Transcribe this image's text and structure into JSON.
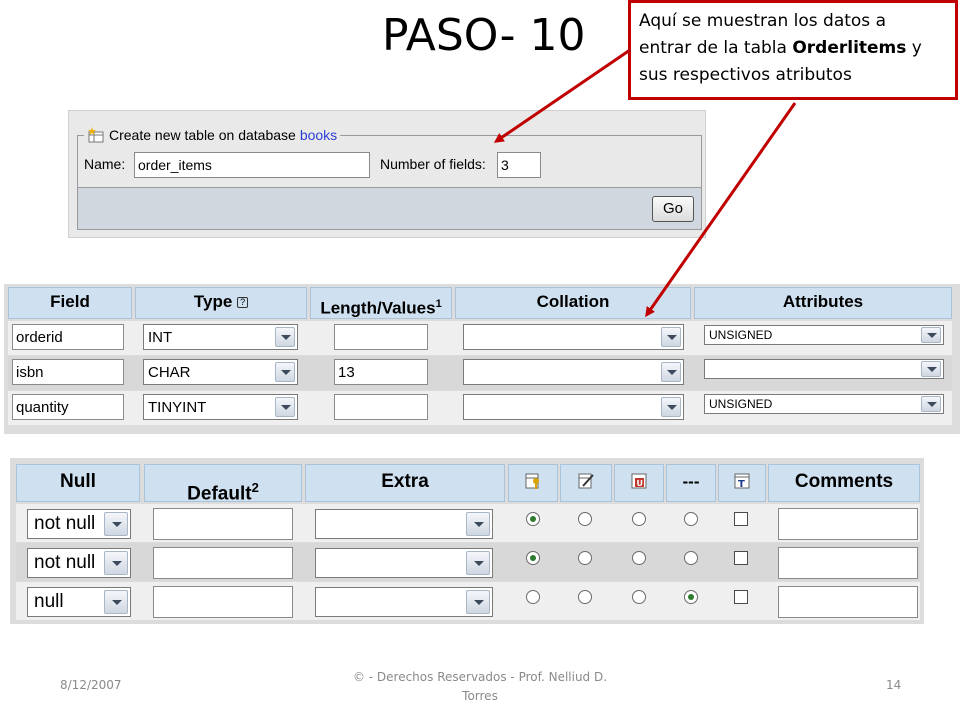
{
  "slide": {
    "title": "PASO- 10",
    "callout": {
      "line1": "Aquí se muestran los datos a",
      "line2_pre": "entrar de la tabla ",
      "line2_bold": "Orderlitems",
      "line2_post": " y",
      "line3": "sus respectivos atributos"
    },
    "arrow_color": "#c00000"
  },
  "create_table": {
    "legend_prefix": "Create new table on database",
    "database": "books",
    "name_label": "Name:",
    "name_value": "order_items",
    "fields_label": "Number of fields:",
    "fields_value": "3",
    "go_label": "Go",
    "legend_icon": "new-table-icon"
  },
  "fields_table": {
    "headers": {
      "field": "Field",
      "type": "Type",
      "length": "Length/Values",
      "length_sup": "1",
      "collation": "Collation",
      "attributes": "Attributes"
    },
    "help_icon": "help-icon",
    "rows": [
      {
        "field": "orderid",
        "type": "INT",
        "length": "",
        "collation": "",
        "attributes": "UNSIGNED"
      },
      {
        "field": "isbn",
        "type": "CHAR",
        "length": "13",
        "collation": "",
        "attributes": ""
      },
      {
        "field": "quantity",
        "type": "TINYINT",
        "length": "",
        "collation": "",
        "attributes": "UNSIGNED"
      }
    ]
  },
  "options_table": {
    "headers": {
      "null": "Null",
      "default": "Default",
      "default_sup": "2",
      "extra": "Extra",
      "primary_icon": "primary-key-icon",
      "index_icon": "index-icon",
      "unique_icon": "unique-icon",
      "none": "---",
      "fulltext_icon": "fulltext-icon",
      "comments": "Comments"
    },
    "rows": [
      {
        "null": "not null",
        "default": "",
        "extra": "",
        "key": "primary",
        "fulltext": false,
        "comments": ""
      },
      {
        "null": "not null",
        "default": "",
        "extra": "",
        "key": "primary",
        "fulltext": false,
        "comments": ""
      },
      {
        "null": "null",
        "default": "",
        "extra": "",
        "key": "none",
        "fulltext": false,
        "comments": ""
      }
    ]
  },
  "footer": {
    "date": "8/12/2007",
    "copyright_line1": "© - Derechos Reservados  - Prof. Nelliud D.",
    "copyright_line2": "Torres",
    "page": "14"
  }
}
